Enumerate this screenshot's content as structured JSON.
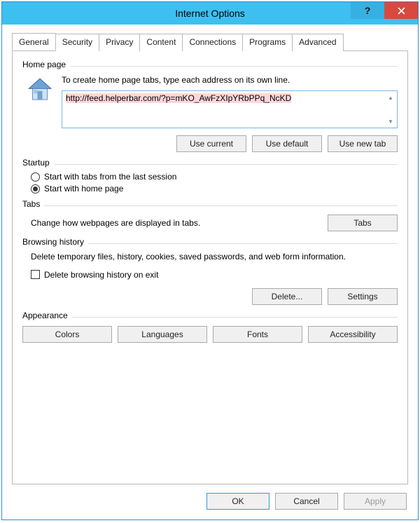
{
  "window": {
    "title": "Internet Options"
  },
  "tabs": {
    "general": "General",
    "security": "Security",
    "privacy": "Privacy",
    "content": "Content",
    "connections": "Connections",
    "programs": "Programs",
    "advanced": "Advanced"
  },
  "homepage": {
    "legend": "Home page",
    "desc": "To create home page tabs, type each address on its own line.",
    "value": "http://feed.helperbar.com/?p=mKO_AwFzXIpYRbPPq_NcKD",
    "use_current": "Use current",
    "use_default": "Use default",
    "use_new_tab": "Use new tab"
  },
  "startup": {
    "legend": "Startup",
    "opt_last": "Start with tabs from the last session",
    "opt_home": "Start with home page",
    "selected": "home"
  },
  "tabs_section": {
    "legend": "Tabs",
    "desc": "Change how webpages are displayed in tabs.",
    "button": "Tabs"
  },
  "history": {
    "legend": "Browsing history",
    "desc": "Delete temporary files, history, cookies, saved passwords, and web form information.",
    "checkbox": "Delete browsing history on exit",
    "delete": "Delete...",
    "settings": "Settings"
  },
  "appearance": {
    "legend": "Appearance",
    "colors": "Colors",
    "languages": "Languages",
    "fonts": "Fonts",
    "accessibility": "Accessibility"
  },
  "footer": {
    "ok": "OK",
    "cancel": "Cancel",
    "apply": "Apply"
  }
}
